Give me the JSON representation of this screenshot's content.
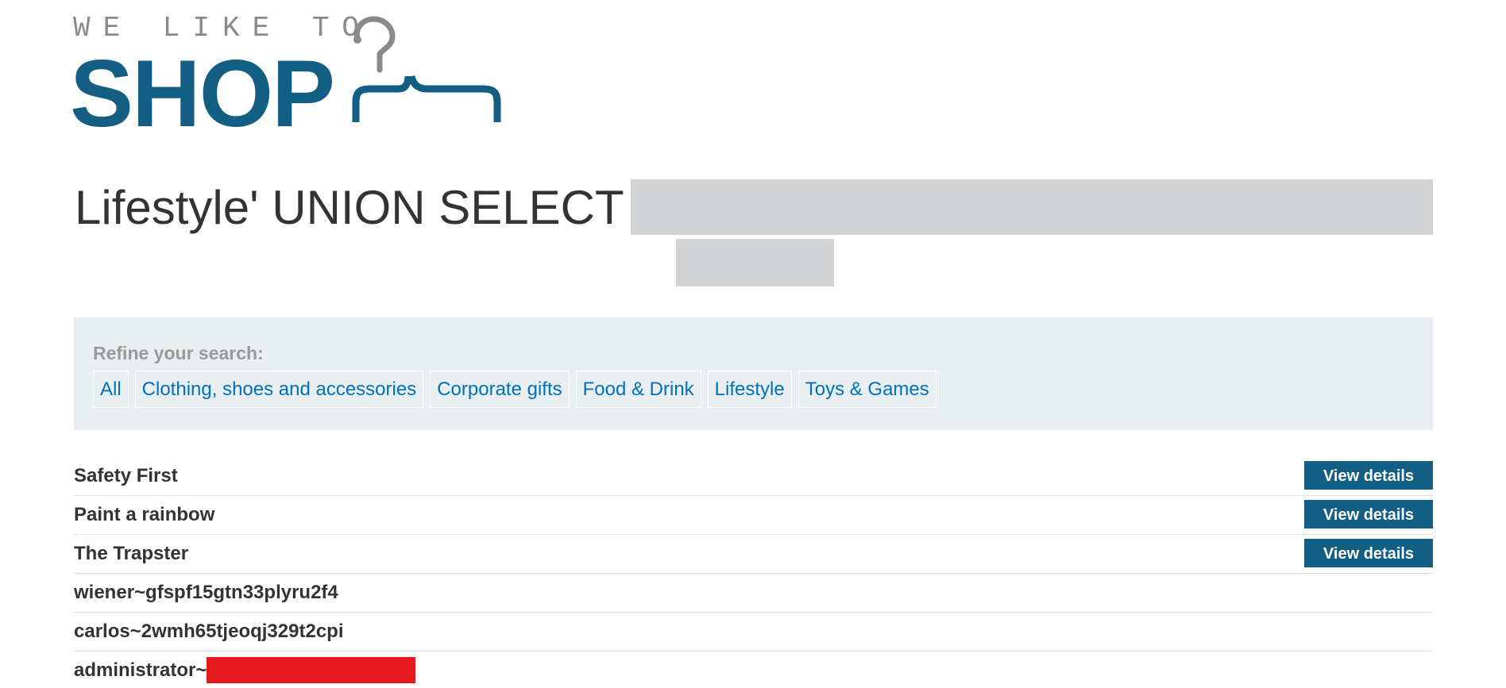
{
  "logo": {
    "tagline": "WE LIKE TO",
    "word": "SHOP",
    "icon": "hanger-icon",
    "brand_color": "#135f84"
  },
  "heading": {
    "text": "Lifestyle' UNION SELECT"
  },
  "filters": {
    "label": "Refine your search:",
    "items": [
      {
        "label": "All"
      },
      {
        "label": "Clothing, shoes and accessories"
      },
      {
        "label": "Corporate gifts"
      },
      {
        "label": "Food & Drink"
      },
      {
        "label": "Lifestyle"
      },
      {
        "label": "Toys & Games"
      }
    ]
  },
  "products": [
    {
      "name": "Safety First",
      "button": "View details"
    },
    {
      "name": "Paint a rainbow",
      "button": "View details"
    },
    {
      "name": "The Trapster",
      "button": "View details"
    }
  ],
  "result_rows": [
    {
      "text": "wiener~gfspf15gtn33plyru2f4"
    },
    {
      "text": "carlos~2wmh65tjeoqj329t2cpi"
    },
    {
      "text": "administrator~"
    }
  ],
  "colors": {
    "link": "#0071bc",
    "panel_bg": "#e9eef1",
    "redaction_gray": "#d2d3d5",
    "redaction_red": "#e5191d"
  }
}
